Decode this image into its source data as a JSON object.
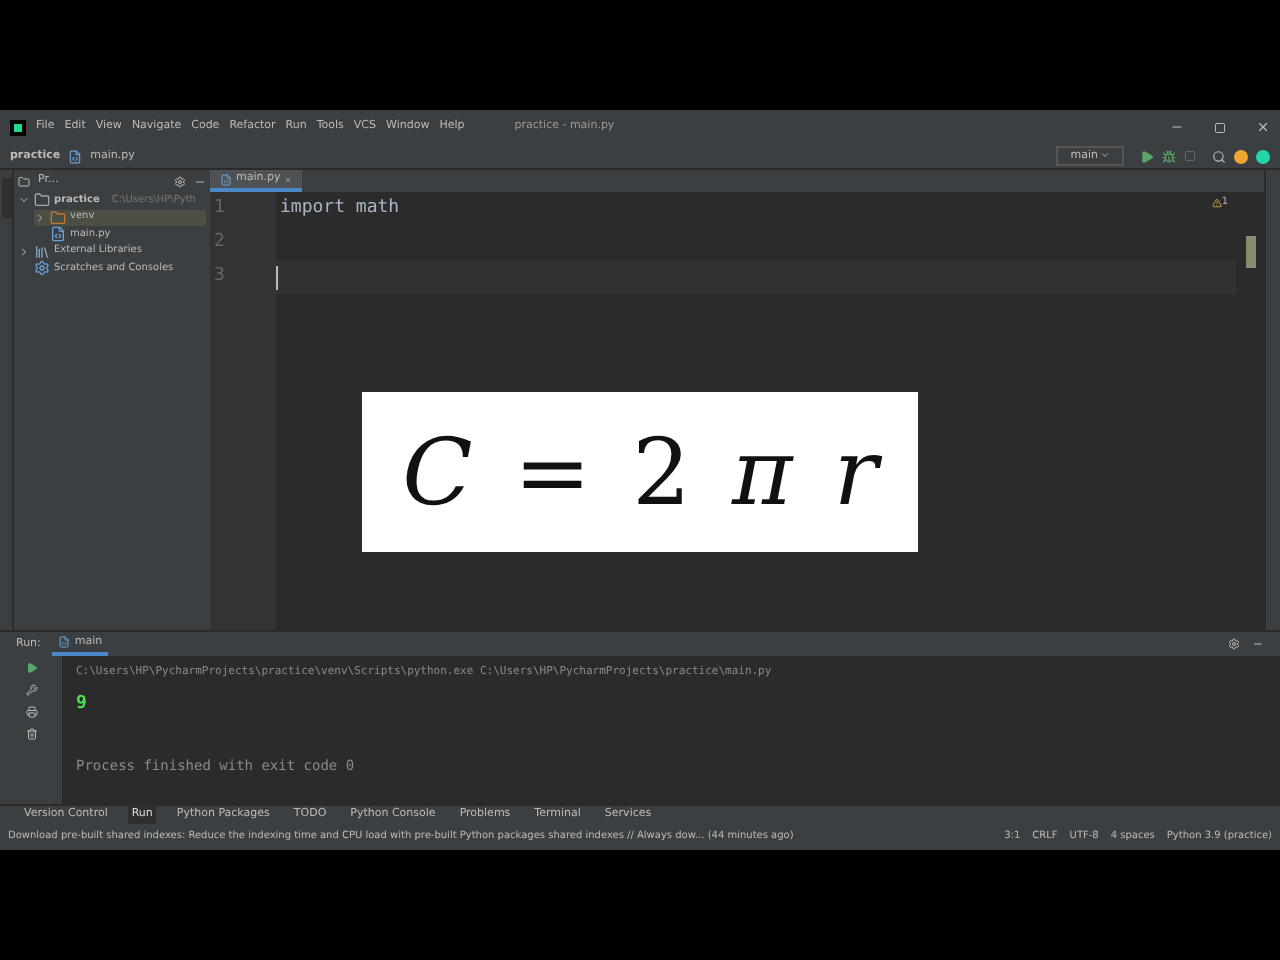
{
  "menu": [
    "File",
    "Edit",
    "View",
    "Navigate",
    "Code",
    "Refactor",
    "Run",
    "Tools",
    "VCS",
    "Window",
    "Help"
  ],
  "window": {
    "title": "practice - main.py"
  },
  "breadcrumbs": [
    "practice",
    "main.py"
  ],
  "run_config": "main",
  "project_panel": {
    "title": "Pr...",
    "tree": [
      {
        "label": "practice",
        "path": "C:\\Users\\HP\\Pyth",
        "expanded": true,
        "kind": "folder",
        "children": [
          {
            "label": "venv",
            "kind": "folder",
            "expanded": false,
            "selected": true
          },
          {
            "label": "main.py",
            "kind": "file",
            "selected": false
          }
        ]
      },
      {
        "label": "External Libraries",
        "kind": "library",
        "expanded": false
      },
      {
        "label": "Scratches and Consoles",
        "kind": "scratch"
      }
    ]
  },
  "editor": {
    "tab": "main.py",
    "warnings": "1",
    "lines": [
      {
        "number": "1",
        "code": "import math"
      },
      {
        "number": "2"
      },
      {
        "number": "3",
        "current": true
      }
    ]
  },
  "formula": "*C* = 2 *π* *r*",
  "run_panel": {
    "label": "Run:",
    "tab": "main",
    "output": [
      {
        "text": "C:\\Users\\HP\\PycharmProjects\\practice\\venv\\Scripts\\python.exe C:\\Users\\HP\\PycharmProjects\\practice\\main.py",
        "kind": "command"
      },
      {
        "text": "9",
        "kind": "result"
      },
      {
        "kind": "blank"
      },
      {
        "text": "Process finished with exit code 0",
        "kind": "info"
      }
    ]
  },
  "tool_tabs": [
    {
      "label": "Version Control",
      "selected": false
    },
    {
      "label": "Run",
      "selected": true
    },
    {
      "label": "Python Packages",
      "selected": false
    },
    {
      "label": "TODO",
      "selected": false
    },
    {
      "label": "Python Console",
      "selected": false
    },
    {
      "label": "Problems",
      "selected": false
    },
    {
      "label": "Terminal",
      "selected": false
    },
    {
      "label": "Services",
      "selected": false
    }
  ],
  "status_bar": {
    "message": "Download pre-built shared indexes: Reduce the indexing time and CPU load with pre-built Python packages shared indexes // Always dow... (44 minutes ago)",
    "items": [
      "3:1",
      "CRLF",
      "UTF-8",
      "4 spaces",
      "Python 3.9 (practice)"
    ]
  }
}
